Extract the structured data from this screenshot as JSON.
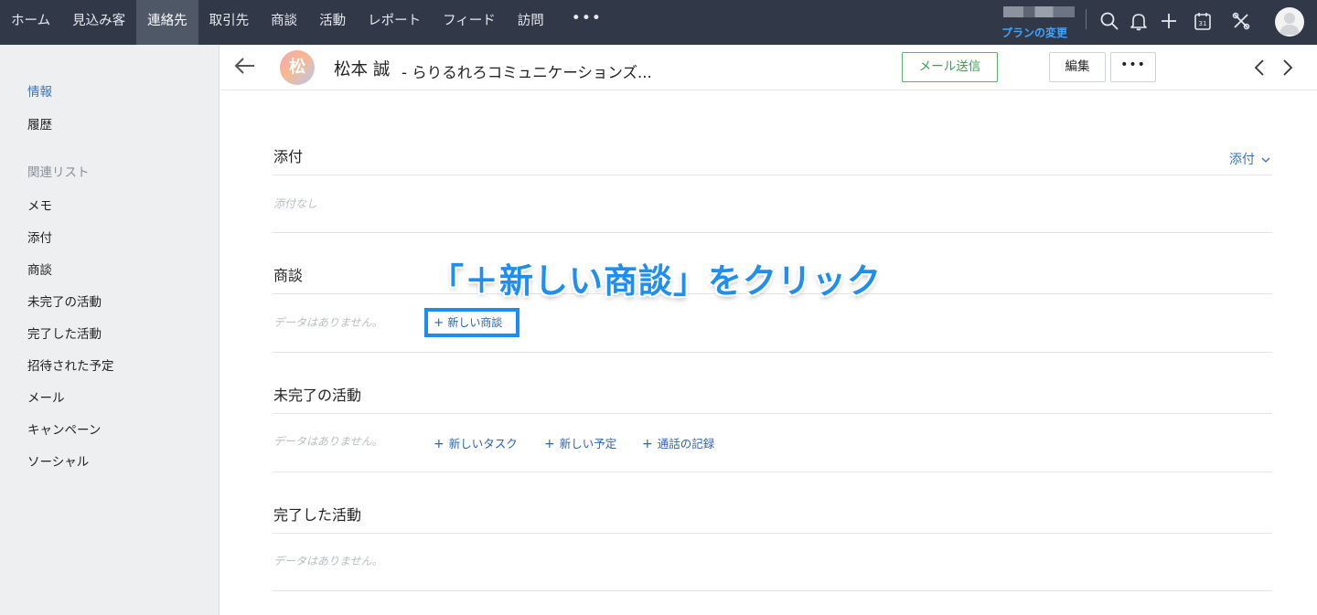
{
  "nav": {
    "items": [
      "ホーム",
      "見込み客",
      "連絡先",
      "取引先",
      "商談",
      "活動",
      "レポート",
      "フィード",
      "訪問"
    ],
    "active_index": 2,
    "more": "•••",
    "plan_link": "プランの変更",
    "icons": [
      "search-icon",
      "bell-icon",
      "plus-icon",
      "calendar-icon",
      "tools-icon",
      "user-avatar"
    ],
    "calendar_day": "31"
  },
  "sidebar": {
    "info": "情報",
    "history": "履歴",
    "related_heading": "関連リスト",
    "related": [
      "メモ",
      "添付",
      "商談",
      "未完了の活動",
      "完了した活動",
      "招待された予定",
      "メール",
      "キャンペーン",
      "ソーシャル"
    ]
  },
  "record": {
    "avatar_letter": "松",
    "name": "松本 誠",
    "company": "- らりるれろコミュニケーションズ...",
    "send_mail": "メール送信",
    "edit": "編集",
    "more": "•••"
  },
  "sections": {
    "attachments": {
      "title": "添付",
      "dropdown": "添付",
      "empty": "添付なし"
    },
    "deals": {
      "title": "商談",
      "empty": "データはありません。",
      "new_deal": "新しい商談"
    },
    "open_activities": {
      "title": "未完了の活動",
      "empty": "データはありません。",
      "actions": [
        "新しいタスク",
        "新しい予定",
        "通話の記録"
      ]
    },
    "closed_activities": {
      "title": "完了した活動",
      "empty": "データはありません。"
    }
  },
  "annotation": {
    "callout": "「＋新しい商談」をクリック"
  },
  "colors": {
    "nav_bg": "#313949",
    "accent_blue": "#1c8ef0",
    "mail_green": "#3e9f53",
    "link_blue": "#2b64b0"
  }
}
